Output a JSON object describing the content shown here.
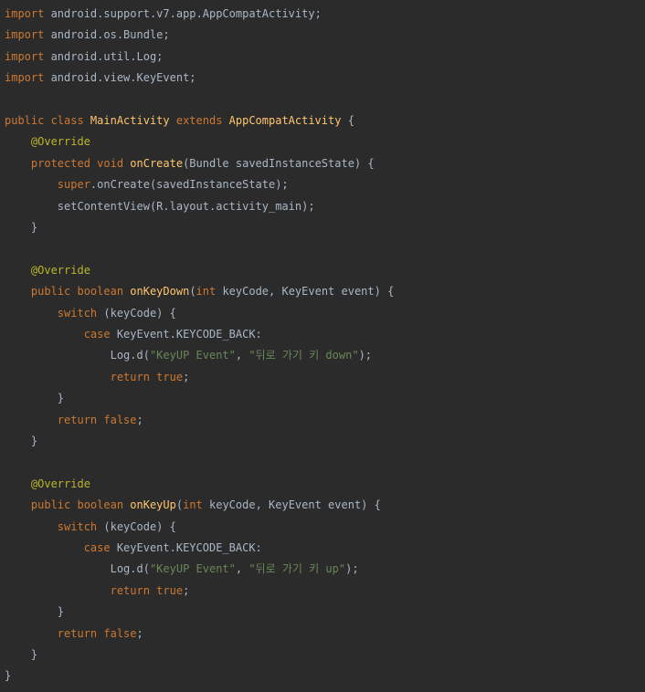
{
  "editor": {
    "background": "#2b2b2b",
    "colors": {
      "plain": "#a9b7c6",
      "keyword": "#cc7832",
      "function": "#ffc66d",
      "annotation": "#bbb529",
      "string": "#6a8759"
    },
    "lines": [
      [
        {
          "t": "keyword",
          "v": "import"
        },
        {
          "t": "plain",
          "v": " android.support.v7.app.AppCompatActivity;"
        }
      ],
      [
        {
          "t": "keyword",
          "v": "import"
        },
        {
          "t": "plain",
          "v": " android.os.Bundle;"
        }
      ],
      [
        {
          "t": "keyword",
          "v": "import"
        },
        {
          "t": "plain",
          "v": " android.util.Log;"
        }
      ],
      [
        {
          "t": "keyword",
          "v": "import"
        },
        {
          "t": "plain",
          "v": " android.view.KeyEvent;"
        }
      ],
      [],
      [
        {
          "t": "keyword",
          "v": "public class "
        },
        {
          "t": "func",
          "v": "MainActivity "
        },
        {
          "t": "keyword",
          "v": "extends "
        },
        {
          "t": "func",
          "v": "AppCompatActivity"
        },
        {
          "t": "plain",
          "v": " {"
        }
      ],
      [
        {
          "t": "plain",
          "v": "    "
        },
        {
          "t": "annotation",
          "v": "@Override"
        }
      ],
      [
        {
          "t": "plain",
          "v": "    "
        },
        {
          "t": "keyword",
          "v": "protected void "
        },
        {
          "t": "func",
          "v": "onCreate"
        },
        {
          "t": "plain",
          "v": "(Bundle savedInstanceState) {"
        }
      ],
      [
        {
          "t": "plain",
          "v": "        "
        },
        {
          "t": "keyword",
          "v": "super"
        },
        {
          "t": "plain",
          "v": ".onCreate(savedInstanceState);"
        }
      ],
      [
        {
          "t": "plain",
          "v": "        setContentView(R.layout.activity_main);"
        }
      ],
      [
        {
          "t": "plain",
          "v": "    }"
        }
      ],
      [],
      [
        {
          "t": "plain",
          "v": "    "
        },
        {
          "t": "annotation",
          "v": "@Override"
        }
      ],
      [
        {
          "t": "plain",
          "v": "    "
        },
        {
          "t": "keyword",
          "v": "public boolean "
        },
        {
          "t": "func",
          "v": "onKeyDown"
        },
        {
          "t": "plain",
          "v": "("
        },
        {
          "t": "keyword",
          "v": "int"
        },
        {
          "t": "plain",
          "v": " keyCode, KeyEvent event) {"
        }
      ],
      [
        {
          "t": "plain",
          "v": "        "
        },
        {
          "t": "keyword",
          "v": "switch"
        },
        {
          "t": "plain",
          "v": " (keyCode) {"
        }
      ],
      [
        {
          "t": "plain",
          "v": "            "
        },
        {
          "t": "keyword",
          "v": "case"
        },
        {
          "t": "plain",
          "v": " KeyEvent.KEYCODE_BACK:"
        }
      ],
      [
        {
          "t": "plain",
          "v": "                Log.d("
        },
        {
          "t": "string",
          "v": "\"KeyUP Event\""
        },
        {
          "t": "plain",
          "v": ", "
        },
        {
          "t": "string",
          "v": "\"뒤로 가기 키 down\""
        },
        {
          "t": "plain",
          "v": ");"
        }
      ],
      [
        {
          "t": "plain",
          "v": "                "
        },
        {
          "t": "keyword",
          "v": "return true"
        },
        {
          "t": "plain",
          "v": ";"
        }
      ],
      [
        {
          "t": "plain",
          "v": "        }"
        }
      ],
      [
        {
          "t": "plain",
          "v": "        "
        },
        {
          "t": "keyword",
          "v": "return false"
        },
        {
          "t": "plain",
          "v": ";"
        }
      ],
      [
        {
          "t": "plain",
          "v": "    }"
        }
      ],
      [],
      [
        {
          "t": "plain",
          "v": "    "
        },
        {
          "t": "annotation",
          "v": "@Override"
        }
      ],
      [
        {
          "t": "plain",
          "v": "    "
        },
        {
          "t": "keyword",
          "v": "public boolean "
        },
        {
          "t": "func",
          "v": "onKeyUp"
        },
        {
          "t": "plain",
          "v": "("
        },
        {
          "t": "keyword",
          "v": "int"
        },
        {
          "t": "plain",
          "v": " keyCode, KeyEvent event) {"
        }
      ],
      [
        {
          "t": "plain",
          "v": "        "
        },
        {
          "t": "keyword",
          "v": "switch"
        },
        {
          "t": "plain",
          "v": " (keyCode) {"
        }
      ],
      [
        {
          "t": "plain",
          "v": "            "
        },
        {
          "t": "keyword",
          "v": "case"
        },
        {
          "t": "plain",
          "v": " KeyEvent.KEYCODE_BACK:"
        }
      ],
      [
        {
          "t": "plain",
          "v": "                Log.d("
        },
        {
          "t": "string",
          "v": "\"KeyUP Event\""
        },
        {
          "t": "plain",
          "v": ", "
        },
        {
          "t": "string",
          "v": "\"뒤로 가기 키 up\""
        },
        {
          "t": "plain",
          "v": ");"
        }
      ],
      [
        {
          "t": "plain",
          "v": "                "
        },
        {
          "t": "keyword",
          "v": "return true"
        },
        {
          "t": "plain",
          "v": ";"
        }
      ],
      [
        {
          "t": "plain",
          "v": "        }"
        }
      ],
      [
        {
          "t": "plain",
          "v": "        "
        },
        {
          "t": "keyword",
          "v": "return false"
        },
        {
          "t": "plain",
          "v": ";"
        }
      ],
      [
        {
          "t": "plain",
          "v": "    }"
        }
      ],
      [
        {
          "t": "plain",
          "v": "}"
        }
      ]
    ]
  }
}
